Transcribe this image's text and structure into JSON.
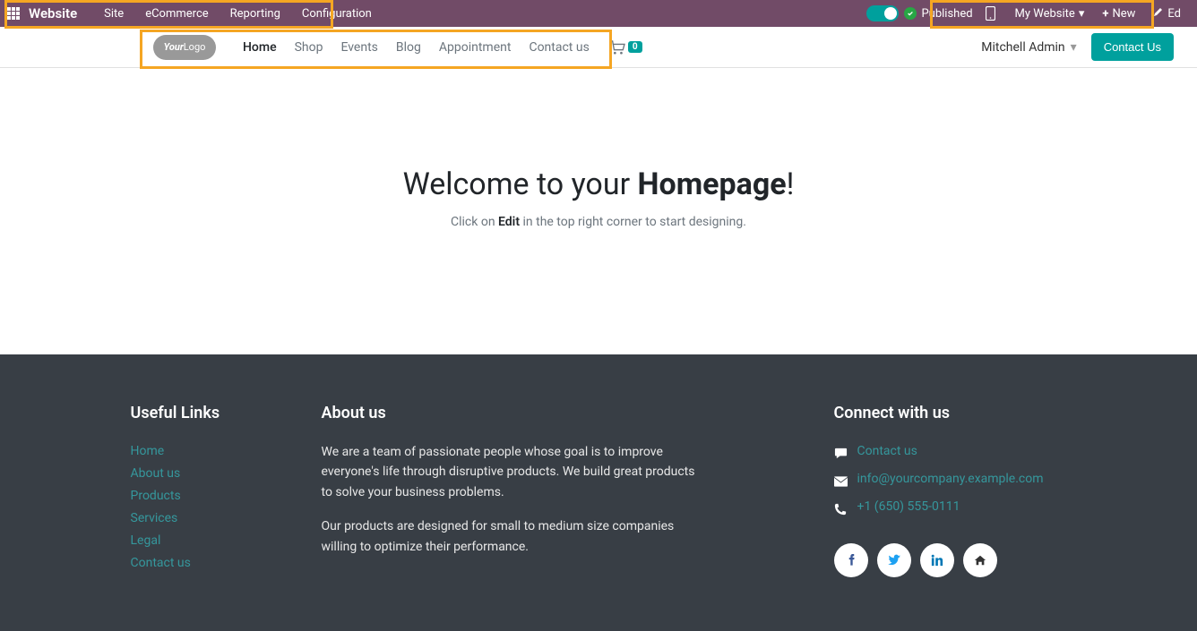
{
  "admin": {
    "brand": "Website",
    "menu": [
      "Site",
      "eCommerce",
      "Reporting",
      "Configuration"
    ],
    "published": "Published",
    "websiteSelector": "My Website",
    "newBtn": "New",
    "editBtn": "Ed"
  },
  "siteNav": {
    "items": [
      "Home",
      "Shop",
      "Events",
      "Blog",
      "Appointment",
      "Contact us"
    ],
    "activeIndex": 0,
    "cartCount": "0",
    "user": "Mitchell Admin",
    "contactBtn": "Contact Us"
  },
  "hero": {
    "titlePrefix": "Welcome to your ",
    "titleBold": "Homepage",
    "titleSuffix": "!",
    "subPrefix": "Click on ",
    "subBold": "Edit",
    "subSuffix": " in the top right corner to start designing."
  },
  "footer": {
    "usefulTitle": "Useful Links",
    "usefulLinks": [
      "Home",
      "About us",
      "Products",
      "Services",
      "Legal",
      "Contact us"
    ],
    "aboutTitle": "About us",
    "aboutP1": "We are a team of passionate people whose goal is to improve everyone's life through disruptive products. We build great products to solve your business problems.",
    "aboutP2": "Our products are designed for small to medium size companies willing to optimize their performance.",
    "connectTitle": "Connect with us",
    "contactLink": "Contact us",
    "email": "info@yourcompany.example.com",
    "phone": "+1 (650) 555-0111"
  }
}
